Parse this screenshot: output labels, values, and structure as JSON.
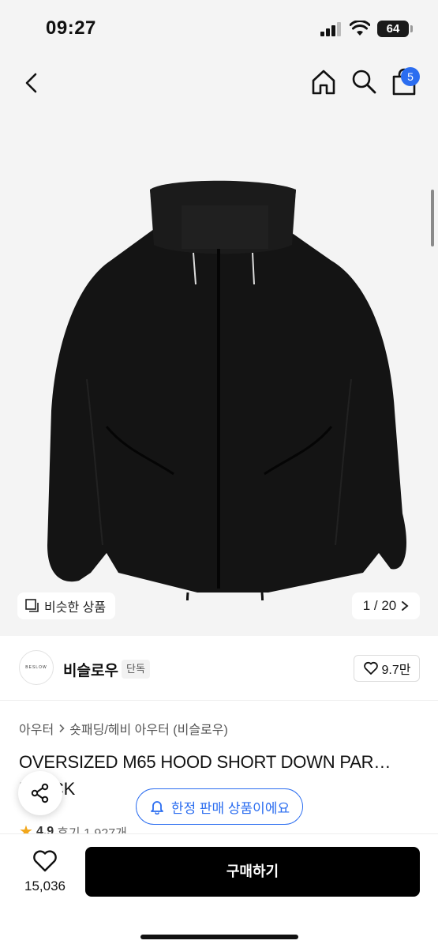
{
  "status_bar": {
    "time": "09:27",
    "battery": "64"
  },
  "nav": {
    "cart_count": "5"
  },
  "colors": {
    "accent": "#2b6df0",
    "star": "#f2a71b",
    "buy_button": "#000000"
  },
  "gallery": {
    "similar_label": "비슷한 상품",
    "page_counter": "1 / 20"
  },
  "brand": {
    "logo_text": "BESLOW",
    "name": "비슬로우",
    "tag": "단독",
    "likes": "9.7만"
  },
  "product": {
    "category_main": "아우터",
    "category_sub": "숏패딩/헤비 아우터 (비슬로우)",
    "title": "OVERSIZED M65 HOOD SHORT DOWN PAR… BLACK",
    "rating": "4.9",
    "reviews": "후기 1,927개"
  },
  "floating": {
    "limited_label": "한정 판매 상품이에요"
  },
  "bottom": {
    "wish_count": "15,036",
    "buy_label": "구매하기"
  },
  "icons": [
    "back-icon",
    "home-icon",
    "search-icon",
    "shopping-bag-icon",
    "similar-items-icon",
    "chevron-right-icon",
    "heart-icon",
    "share-icon",
    "bell-icon",
    "star-icon"
  ]
}
